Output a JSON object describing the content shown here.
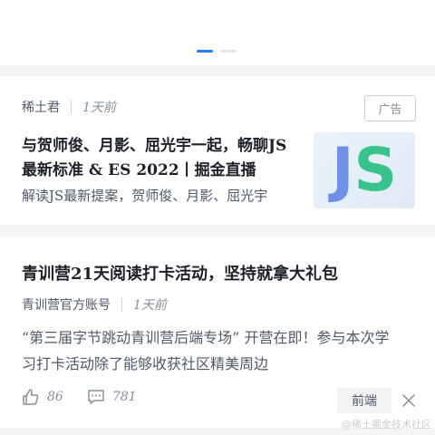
{
  "carousel": {
    "dots": 2,
    "active_index": 0
  },
  "ad_card": {
    "author": "稀土君",
    "time": "1天前",
    "badge": "广告",
    "title": "与贺师俊、月影、屈光宇一起，畅聊JS最新标准 & ES 2022丨掘金直播",
    "abstract": "解读JS最新提案，贺师俊、月影、屈光宇",
    "thumbnail": {
      "icon": "js-logo",
      "text_j": "J",
      "text_s": "S"
    }
  },
  "post_card": {
    "title": "青训营21天阅读打卡活动，坚持就拿大礼包",
    "author": "青训营官方账号",
    "time": "1天前",
    "abstract": "“第三届字节跳动青训营后端专场” 开营在即！参与本次学习打卡活动除了能够收获社区精美周边",
    "likes": "86",
    "comments": "781",
    "tag": "前端"
  },
  "watermark": "@稀土掘金技术社区",
  "colors": {
    "accent": "#1e80ff",
    "background": "#f4f5f5",
    "card": "#ffffff"
  }
}
